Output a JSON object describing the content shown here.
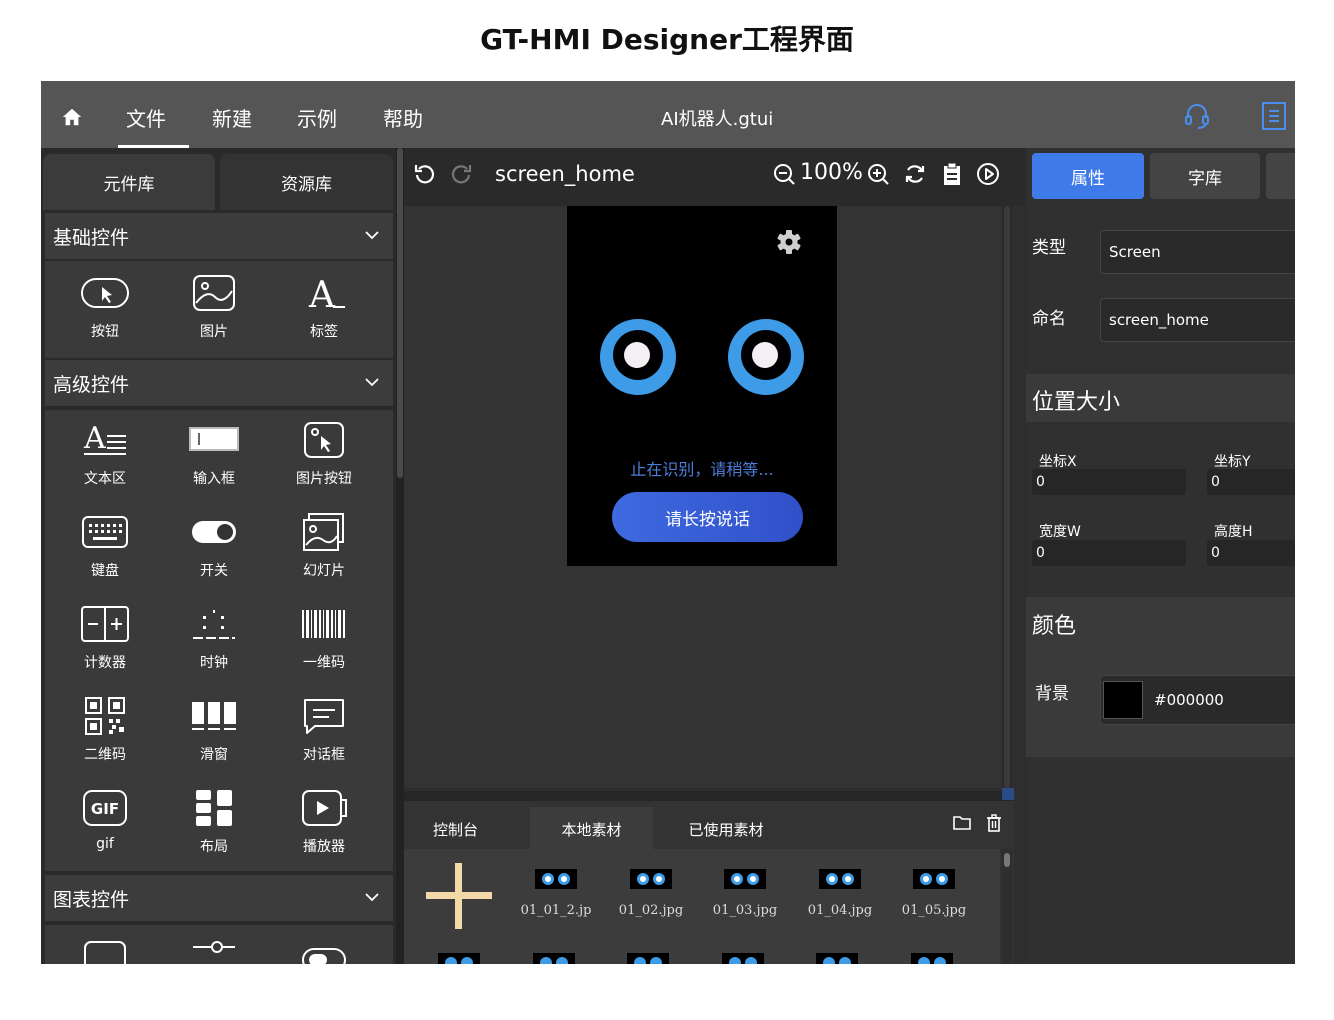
{
  "caption": "GT-HMI Designer工程界面",
  "menu": {
    "items": [
      "文件",
      "新建",
      "示例",
      "帮助"
    ],
    "file_title": "AI机器人.gtui"
  },
  "left": {
    "tabs": [
      "元件库",
      "资源库"
    ],
    "sections": {
      "basic": {
        "title": "基础控件",
        "items": [
          "按钮",
          "图片",
          "标签"
        ]
      },
      "advanced": {
        "title": "高级控件",
        "items": [
          "文本区",
          "输入框",
          "图片按钮",
          "键盘",
          "开关",
          "幻灯片",
          "计数器",
          "时钟",
          "一维码",
          "二维码",
          "滑窗",
          "对话框",
          "gif",
          "布局",
          "播放器"
        ]
      },
      "chart": {
        "title": "图表控件"
      }
    }
  },
  "center": {
    "screen_name": "screen_home",
    "zoom": "100%",
    "phone": {
      "status": "止在识别，请稍等...",
      "button": "请长按说话"
    },
    "bottom": {
      "tabs": [
        "控制台",
        "本地素材",
        "已使用素材"
      ],
      "assets": [
        "01_01_2.jp",
        "01_02.jpg",
        "01_03.jpg",
        "01_04.jpg",
        "01_05.jpg"
      ]
    }
  },
  "right": {
    "tabs": [
      "属性",
      "字库"
    ],
    "type_label": "类型",
    "type_value": "Screen",
    "name_label": "命名",
    "name_value": "screen_home",
    "pos_title": "位置大小",
    "x_label": "坐标X",
    "x_value": "0",
    "y_label": "坐标Y",
    "y_value": "0",
    "w_label": "宽度W",
    "w_value": "0",
    "h_label": "高度H",
    "h_value": "0",
    "color_title": "颜色",
    "bg_label": "背景",
    "bg_value": "#000000"
  },
  "colors": {
    "accent": "#3f7be8",
    "eye_blue": "#3d9be8",
    "status_text": "#4e7ed9"
  }
}
